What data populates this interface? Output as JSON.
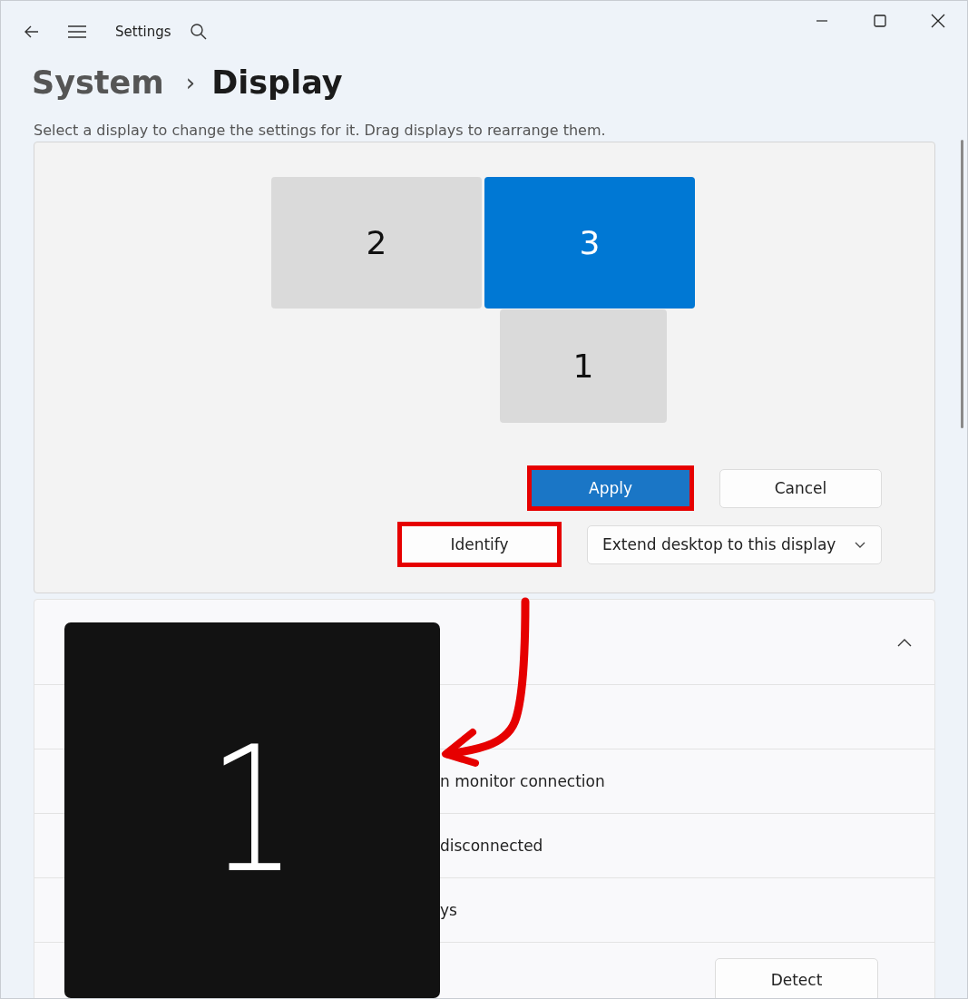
{
  "window": {
    "title": "Settings"
  },
  "breadcrumb": {
    "parent": "System",
    "separator": "›",
    "current": "Display"
  },
  "description": "Select a display to change the settings for it. Drag displays to rearrange them.",
  "monitors": [
    {
      "label": "2",
      "selected": false,
      "kind": "left"
    },
    {
      "label": "3",
      "selected": true,
      "kind": "right"
    },
    {
      "label": "1",
      "selected": false,
      "kind": "below"
    }
  ],
  "actions": [
    {
      "label": "Apply",
      "kind": "primary",
      "highlighted": true
    },
    {
      "label": "Cancel",
      "kind": "secondary",
      "highlighted": false
    }
  ],
  "identify": {
    "label": "Identify",
    "highlighted": true
  },
  "mode_dropdown": {
    "value": "Extend desktop to this display"
  },
  "section": {
    "expanded": true,
    "rows": [
      {
        "text": ""
      },
      {
        "text": "n monitor connection"
      },
      {
        "text": "disconnected"
      },
      {
        "text": "ys"
      },
      {
        "button": "Detect"
      }
    ]
  },
  "identify_overlay": {
    "number": "1"
  }
}
